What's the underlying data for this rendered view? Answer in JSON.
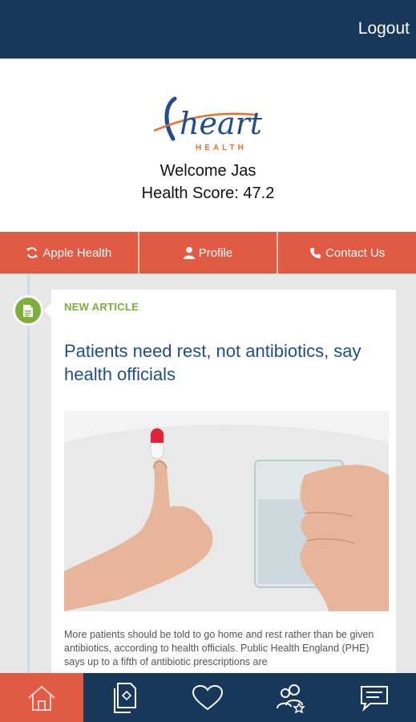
{
  "topbar": {
    "logout_label": "Logout"
  },
  "header": {
    "logo_main": "heart",
    "logo_sub": "HEALTH",
    "welcome": "Welcome Jas",
    "health_score": "Health Score: 47.2"
  },
  "actions": {
    "apple_health": "Apple Health",
    "profile": "Profile",
    "contact_us": "Contact Us"
  },
  "feed": {
    "article": {
      "tag": "NEW ARTICLE",
      "title": "Patients need rest, not antibiotics, say health officials",
      "excerpt": "More patients should be told to go home and rest rather than be given antibiotics, according to health officials. Public Health England (PHE) says up to a fifth of antibiotic prescriptions are"
    }
  },
  "bottom_nav": {
    "items": [
      {
        "icon": "home-icon",
        "active": true
      },
      {
        "icon": "documents-icon",
        "active": false
      },
      {
        "icon": "heart-icon",
        "active": false
      },
      {
        "icon": "people-star-icon",
        "active": false
      },
      {
        "icon": "chat-icon",
        "active": false
      }
    ]
  },
  "colors": {
    "navy": "#17385a",
    "accent": "#e05a44",
    "green": "#7fae3c",
    "title_blue": "#1f4e8c"
  }
}
